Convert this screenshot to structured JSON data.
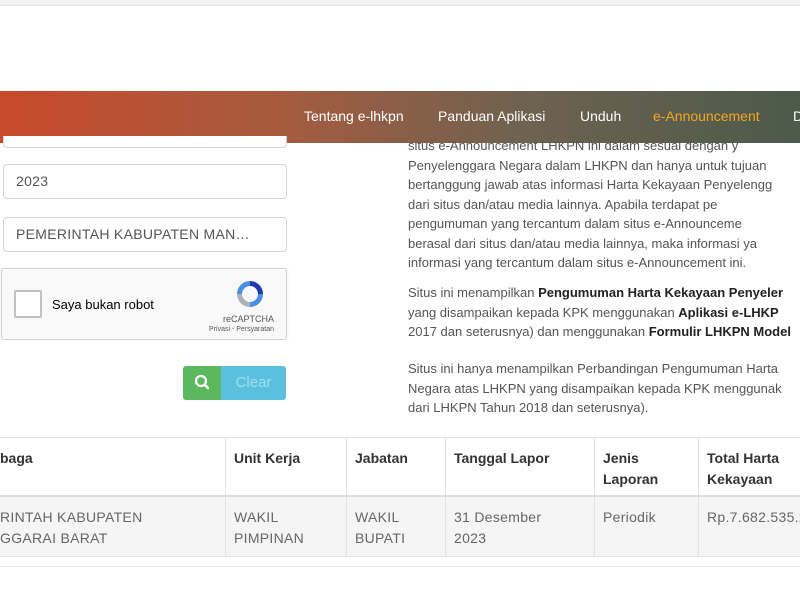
{
  "nav": {
    "items": [
      "Tentang e-lhkpn",
      "Panduan Aplikasi",
      "Unduh",
      "e-Announcement",
      "D"
    ],
    "active_index": 3,
    "active_color": "#f5a623"
  },
  "form": {
    "year_value": "2023",
    "agency_value": "PEMERINTAH KABUPATEN MAN…",
    "recaptcha": {
      "label": "Saya bukan robot",
      "brand": "reCAPTCHA",
      "links": "Privasi - Persyaratan"
    },
    "search_icon": "search-icon",
    "clear_label": "Clear"
  },
  "info": {
    "p1": [
      "situs e-Announcement LHKPN ini dalam sesuai dengan y",
      "Penyelenggara Negara dalam LHKPN dan hanya untuk tujuan",
      "bertanggung jawab atas informasi Harta Kekayaan Penyelengg",
      "dari situs dan/atau media lainnya. Apabila terdapat pe",
      "pengumuman yang tercantum dalam situs e-Announceme",
      "berasal dari situs dan/atau media lainnya, maka informasi ya",
      "informasi yang tercantum dalam situs e-Announcement ini."
    ],
    "p2": {
      "l1_pre": "Situs ini menampilkan ",
      "l1_bold": "Pengumuman Harta Kekayaan Penyeler",
      "l2_pre": "yang disampaikan kepada KPK menggunakan ",
      "l2_bold": "Aplikasi e-LHKP",
      "l3_pre": "2017 dan seterusnya) dan menggunakan ",
      "l3_bold": "Formulir LHKPN Model"
    },
    "p3": [
      "Situs ini hanya menampilkan Perbandingan Pengumuman Harta",
      "Negara atas LHKPN yang disampaikan kepada KPK menggunak",
      "dari LHKPN Tahun 2018 dan seterusnya)."
    ]
  },
  "table": {
    "headers": [
      "baga",
      "Unit Kerja",
      "Jabatan",
      "Tanggal Lapor",
      "Jenis\nLaporan",
      "Total Harta\nKekayaan"
    ],
    "row": [
      "RINTAH KABUPATEN\nGGARAI BARAT",
      "WAKIL\nPIMPINAN",
      "WAKIL\nBUPATI",
      "31 Desember\n2023",
      "Periodik",
      "Rp.7.682.535.2"
    ]
  }
}
